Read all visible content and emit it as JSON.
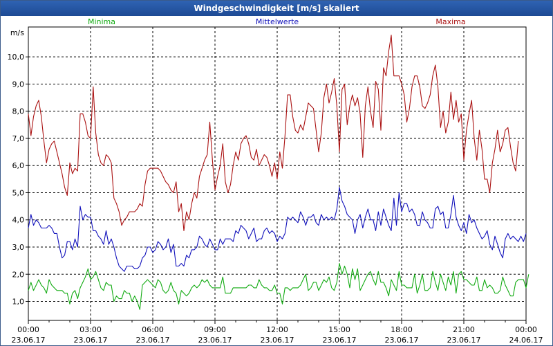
{
  "window": {
    "title": "Windgeschwindigkeit [m/s] skaliert"
  },
  "colors": {
    "minima": "#11aa11",
    "mittel": "#1111bb",
    "maxima": "#aa1111",
    "grid": "#000000",
    "titlebar": "#2453a1"
  },
  "chart_data": {
    "type": "line",
    "title": "Windgeschwindigkeit [m/s] skaliert",
    "ylabel": "m/s",
    "xlabel": "",
    "ylim": [
      0.3,
      11.1
    ],
    "xlim": [
      0,
      24
    ],
    "grid": true,
    "legend": "top",
    "yticks": [
      {
        "value": 1,
        "label": "1,0"
      },
      {
        "value": 2,
        "label": "2,0"
      },
      {
        "value": 3,
        "label": "3,0"
      },
      {
        "value": 4,
        "label": "4,0"
      },
      {
        "value": 5,
        "label": "5,0"
      },
      {
        "value": 6,
        "label": "6,0"
      },
      {
        "value": 7,
        "label": "7,0"
      },
      {
        "value": 8,
        "label": "8,0"
      },
      {
        "value": 9,
        "label": "9,0"
      },
      {
        "value": 10,
        "label": "10,0"
      }
    ],
    "xticks": [
      {
        "value": 0,
        "time": "00:00",
        "date": "23.06.17"
      },
      {
        "value": 3,
        "time": "03:00",
        "date": "23.06.17"
      },
      {
        "value": 6,
        "time": "06:00",
        "date": "23.06.17"
      },
      {
        "value": 9,
        "time": "09:00",
        "date": "23.06.17"
      },
      {
        "value": 12,
        "time": "12:00",
        "date": "23.06.17"
      },
      {
        "value": 15,
        "time": "15:00",
        "date": "23.06.17"
      },
      {
        "value": 18,
        "time": "18:00",
        "date": "23.06.17"
      },
      {
        "value": 21,
        "time": "21:00",
        "date": "23.06.17"
      },
      {
        "value": 24,
        "time": "00:00",
        "date": "24.06.17"
      }
    ],
    "series": [
      {
        "name": "Maxima",
        "x_start": 0,
        "x_step": 0.125,
        "values": [
          7.9,
          7.1,
          7.8,
          8.2,
          8.4,
          7.8,
          6.9,
          6.1,
          6.6,
          6.8,
          6.9,
          6.5,
          6.1,
          5.7,
          5.2,
          4.9,
          6.1,
          5.7,
          5.9,
          5.8,
          7.9,
          7.9,
          7.6,
          7.1,
          7.0,
          8.9,
          7.2,
          6.4,
          6.1,
          6.0,
          6.4,
          6.3,
          6.1,
          4.8,
          4.6,
          4.3,
          3.8,
          4.0,
          4.1,
          4.3,
          4.3,
          4.3,
          4.4,
          4.6,
          4.5,
          5.3,
          5.8,
          5.9,
          5.9,
          5.9,
          5.9,
          5.8,
          5.6,
          5.4,
          5.3,
          5.1,
          5.0,
          5.4,
          4.3,
          4.6,
          3.6,
          4.3,
          4.0,
          4.6,
          5.0,
          4.8,
          5.6,
          5.9,
          6.2,
          6.4,
          7.6,
          6.2,
          5.1,
          5.6,
          6.0,
          6.8,
          5.4,
          5.0,
          5.3,
          6.0,
          6.5,
          6.2,
          6.8,
          7.0,
          7.1,
          6.8,
          6.3,
          6.2,
          6.6,
          6.0,
          6.2,
          6.4,
          6.3,
          6.0,
          5.6,
          6.1,
          5.5,
          6.5,
          5.9,
          7.1,
          8.6,
          8.6,
          7.8,
          7.3,
          7.2,
          7.5,
          7.3,
          7.8,
          8.3,
          8.2,
          8.1,
          7.3,
          6.5,
          7.2,
          8.5,
          9.0,
          8.3,
          8.7,
          9.2,
          8.2,
          6.5,
          8.8,
          9.0,
          7.5,
          8.2,
          8.6,
          8.2,
          8.5,
          7.9,
          6.3,
          8.2,
          8.9,
          8.0,
          7.4,
          9.1,
          8.8,
          7.3,
          9.6,
          9.3,
          10.2,
          10.8,
          9.3,
          9.3,
          9.3,
          9.0,
          8.6,
          7.6,
          8.1,
          8.9,
          9.3,
          9.3,
          8.9,
          8.2,
          8.1,
          8.3,
          8.6,
          9.3,
          9.7,
          8.9,
          7.4,
          8.0,
          7.2,
          7.6,
          8.7,
          7.7,
          8.4,
          7.6,
          7.9,
          6.2,
          7.3,
          7.9,
          8.4,
          7.0,
          6.2,
          7.3,
          6.6,
          5.5,
          5.5,
          5.0,
          6.1,
          6.6,
          7.3,
          6.5,
          6.8,
          7.3,
          7.4,
          6.7,
          6.1,
          5.8,
          6.9
        ]
      },
      {
        "name": "Mittelwerte",
        "x_start": 0,
        "x_step": 0.125,
        "values": [
          3.7,
          4.2,
          3.8,
          4.0,
          3.9,
          3.7,
          3.7,
          3.7,
          3.8,
          3.7,
          3.5,
          3.5,
          3.0,
          2.6,
          2.7,
          3.2,
          3.2,
          2.9,
          3.3,
          3.0,
          4.5,
          4.0,
          4.2,
          4.1,
          4.1,
          3.6,
          3.6,
          3.4,
          3.3,
          3.1,
          3.6,
          3.1,
          3.3,
          3.0,
          2.6,
          2.3,
          2.2,
          2.1,
          2.3,
          2.3,
          2.3,
          2.2,
          2.2,
          2.3,
          2.6,
          2.7,
          3.0,
          3.0,
          2.8,
          2.9,
          3.2,
          3.1,
          2.9,
          3.0,
          3.3,
          2.8,
          3.1,
          2.3,
          2.3,
          2.4,
          2.3,
          2.7,
          2.6,
          2.9,
          2.9,
          3.0,
          3.4,
          3.3,
          3.1,
          3.0,
          3.3,
          3.1,
          2.9,
          2.9,
          3.3,
          3.1,
          3.3,
          3.3,
          3.3,
          3.2,
          3.6,
          3.5,
          3.8,
          3.7,
          3.6,
          3.3,
          3.5,
          3.7,
          3.2,
          3.3,
          3.3,
          3.6,
          3.7,
          3.5,
          3.6,
          3.5,
          3.2,
          3.4,
          3.3,
          3.5,
          4.1,
          4.0,
          4.1,
          4.0,
          3.9,
          4.3,
          4.1,
          3.8,
          4.1,
          4.1,
          4.2,
          3.9,
          3.8,
          4.2,
          4.0,
          4.1,
          4.0,
          4.1,
          4.0,
          4.4,
          5.2,
          4.7,
          4.5,
          4.2,
          4.1,
          4.0,
          3.5,
          4.0,
          4.2,
          3.7,
          4.1,
          4.4,
          4.0,
          4.0,
          3.6,
          4.3,
          3.8,
          4.4,
          4.1,
          3.8,
          3.6,
          4.8,
          3.8,
          5.0,
          4.3,
          4.6,
          4.6,
          4.3,
          4.4,
          4.2,
          3.8,
          3.8,
          4.3,
          4.0,
          3.9,
          3.7,
          3.7,
          4.4,
          4.5,
          4.2,
          4.3,
          3.7,
          3.7,
          4.2,
          4.9,
          4.1,
          3.8,
          3.6,
          3.9,
          3.5,
          4.2,
          3.9,
          4.0,
          3.7,
          3.5,
          3.3,
          3.4,
          3.6,
          3.1,
          2.9,
          3.4,
          3.1,
          2.8,
          2.6,
          3.3,
          3.5,
          3.3,
          3.4,
          3.3,
          3.2,
          3.4,
          3.2,
          3.5
        ]
      },
      {
        "name": "Minima",
        "x_start": 0,
        "x_step": 0.125,
        "values": [
          1.4,
          1.7,
          1.4,
          1.6,
          1.8,
          1.6,
          1.5,
          1.3,
          1.8,
          1.6,
          1.5,
          1.4,
          1.4,
          1.4,
          1.3,
          1.3,
          0.9,
          1.3,
          1.4,
          1.1,
          1.5,
          1.7,
          1.9,
          2.2,
          1.8,
          1.9,
          2.1,
          1.8,
          1.5,
          1.4,
          1.7,
          1.6,
          1.6,
          1.0,
          1.2,
          1.1,
          1.1,
          1.4,
          1.3,
          1.3,
          1.0,
          1.2,
          1.0,
          0.7,
          1.6,
          1.7,
          1.8,
          1.7,
          1.6,
          1.5,
          1.8,
          1.7,
          1.4,
          1.3,
          1.4,
          1.7,
          1.4,
          1.3,
          0.9,
          1.4,
          1.3,
          1.2,
          1.3,
          1.5,
          1.6,
          1.5,
          1.6,
          1.8,
          1.7,
          1.8,
          1.6,
          1.5,
          1.5,
          1.5,
          1.5,
          1.9,
          1.3,
          1.3,
          1.3,
          1.5,
          1.5,
          1.5,
          1.5,
          1.5,
          1.5,
          1.6,
          1.6,
          1.5,
          1.5,
          1.8,
          1.6,
          1.5,
          1.5,
          1.4,
          1.4,
          1.6,
          1.3,
          1.3,
          0.9,
          1.5,
          1.5,
          1.4,
          1.5,
          1.5,
          1.5,
          1.6,
          1.8,
          2.0,
          1.4,
          1.5,
          1.7,
          1.7,
          1.4,
          1.6,
          1.8,
          1.7,
          1.9,
          1.5,
          1.4,
          1.7,
          2.4,
          2.0,
          2.3,
          2.0,
          1.5,
          2.2,
          1.8,
          2.2,
          1.4,
          1.6,
          1.8,
          2.0,
          2.1,
          1.8,
          1.6,
          2.1,
          1.7,
          1.7,
          1.5,
          1.2,
          1.8,
          1.6,
          1.4,
          2.1,
          1.6,
          1.6,
          1.5,
          1.5,
          1.5,
          2.0,
          1.3,
          1.6,
          2.0,
          1.4,
          1.4,
          1.5,
          2.1,
          1.7,
          1.4,
          2.0,
          1.7,
          1.4,
          1.9,
          1.6,
          2.1,
          1.3,
          2.0,
          2.1,
          1.8,
          1.8,
          1.7,
          1.6,
          1.6,
          1.9,
          1.4,
          1.4,
          1.8,
          1.5,
          1.6,
          1.5,
          1.3,
          1.3,
          1.4,
          1.9,
          1.6,
          1.4,
          1.2,
          1.2,
          1.7,
          1.8,
          1.8,
          1.8,
          1.5,
          2.0
        ]
      }
    ]
  }
}
